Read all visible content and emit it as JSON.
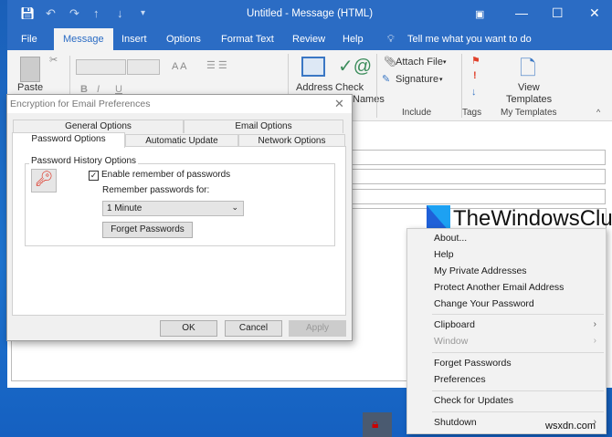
{
  "window": {
    "title": "Untitled  -  Message (HTML)"
  },
  "ribbon_tabs": [
    "File",
    "Message",
    "Insert",
    "Options",
    "Format Text",
    "Review",
    "Help"
  ],
  "tell_me": "Tell me what you want to do",
  "ribbon": {
    "paste": "Paste",
    "address": "Address",
    "check": "Check",
    "check2": "Names",
    "attach": "Attach File",
    "signature": "Signature",
    "include": "Include",
    "tags": "Tags",
    "view": "View",
    "templates": "Templates",
    "my_templates": "My Templates",
    "bold": "B",
    "italic": "I",
    "underline": "U"
  },
  "dialog": {
    "title": "Encryption for Email Preferences",
    "tabs_row1": [
      "General Options",
      "Email Options"
    ],
    "tabs_row2": [
      "Password Options",
      "Automatic Update",
      "Network Options"
    ],
    "group_label": "Password History Options",
    "checkbox_label": "Enable remember of passwords",
    "checkbox_checked": true,
    "remember_label": "Remember passwords for:",
    "remember_value": "1 Minute",
    "forget_button": "Forget Passwords",
    "ok": "OK",
    "cancel": "Cancel",
    "apply": "Apply"
  },
  "logo": "TheWindowsClub",
  "menu": {
    "items": [
      "About...",
      "Help",
      "My Private Addresses",
      "Protect Another Email Address",
      "Change Your Password",
      "Clipboard",
      "Window",
      "Forget Passwords",
      "Preferences",
      "Check for Updates",
      "Shutdown"
    ]
  },
  "watermark": "wsxdn.com"
}
